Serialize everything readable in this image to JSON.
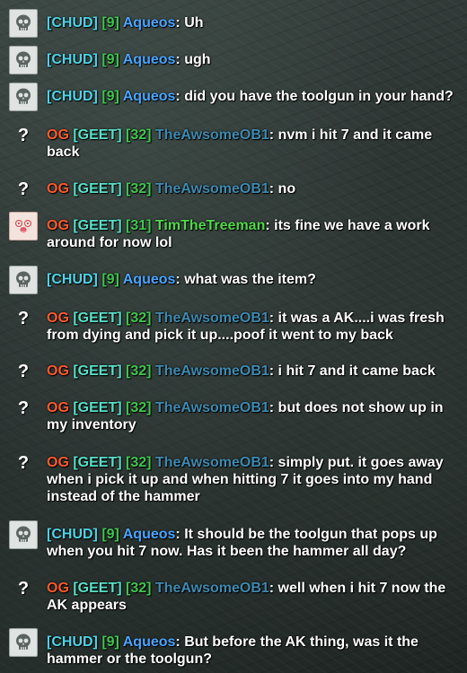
{
  "colors": {
    "og": "#ff5a2c",
    "tag_chud": "#4fd3e6",
    "tag_geet": "#57e0c8",
    "level": "#3fc64f",
    "aqueos": "#4aa5ff",
    "theawsomeob1": "#3f8ab0",
    "timthetreeman": "#52d84a",
    "message_text": "#ffffff"
  },
  "messages": [
    {
      "avatar": "skull-avatar",
      "prefix": "",
      "tag": "[CHUD]",
      "level": "[9]",
      "name": "Aqueos",
      "text": ": Uh"
    },
    {
      "avatar": "skull-avatar",
      "prefix": "",
      "tag": "[CHUD]",
      "level": "[9]",
      "name": "Aqueos",
      "text": ": ugh"
    },
    {
      "avatar": "skull-avatar",
      "prefix": "",
      "tag": "[CHUD]",
      "level": "[9]",
      "name": "Aqueos",
      "text": ": did you have the toolgun in your hand?"
    },
    {
      "avatar": "unknown-avatar",
      "avatar_glyph": "?",
      "prefix": "OG",
      "tag": "[GEET]",
      "level": "[32]",
      "name": "TheAwsomeOB1",
      "text": ": nvm i hit 7 and it came back"
    },
    {
      "avatar": "unknown-avatar",
      "avatar_glyph": "?",
      "prefix": "OG",
      "tag": "[GEET]",
      "level": "[32]",
      "name": "TheAwsomeOB1",
      "text": ": no"
    },
    {
      "avatar": "face-avatar",
      "prefix": "OG",
      "tag": "[GEET]",
      "level": "[31]",
      "name": "TimTheTreeman",
      "text": ": its fine we have a work around for now lol"
    },
    {
      "avatar": "skull-avatar",
      "prefix": "",
      "tag": "[CHUD]",
      "level": "[9]",
      "name": "Aqueos",
      "text": ": what was the item?"
    },
    {
      "avatar": "unknown-avatar",
      "avatar_glyph": "?",
      "prefix": "OG",
      "tag": "[GEET]",
      "level": "[32]",
      "name": "TheAwsomeOB1",
      "text": ": it was a AK....i was fresh from dying and pick it up....poof it went to my back"
    },
    {
      "avatar": "unknown-avatar",
      "avatar_glyph": "?",
      "prefix": "OG",
      "tag": "[GEET]",
      "level": "[32]",
      "name": "TheAwsomeOB1",
      "text": ": i hit 7 and it came back"
    },
    {
      "avatar": "unknown-avatar",
      "avatar_glyph": "?",
      "prefix": "OG",
      "tag": "[GEET]",
      "level": "[32]",
      "name": "TheAwsomeOB1",
      "text": ": but does not show up in my inventory"
    },
    {
      "avatar": "unknown-avatar",
      "avatar_glyph": "?",
      "prefix": "OG",
      "tag": "[GEET]",
      "level": "[32]",
      "name": "TheAwsomeOB1",
      "text": ": simply put. it goes away when i pick it up and when hitting 7 it goes into my hand instead of the hammer"
    },
    {
      "avatar": "skull-avatar",
      "prefix": "",
      "tag": "[CHUD]",
      "level": "[9]",
      "name": "Aqueos",
      "text": ": It should be the toolgun that pops up when you hit 7 now. Has it been the hammer all day?"
    },
    {
      "avatar": "unknown-avatar",
      "avatar_glyph": "?",
      "prefix": "OG",
      "tag": "[GEET]",
      "level": "[32]",
      "name": "TheAwsomeOB1",
      "text": ": well when i hit 7 now the AK appears"
    },
    {
      "avatar": "skull-avatar",
      "prefix": "",
      "tag": "[CHUD]",
      "level": "[9]",
      "name": "Aqueos",
      "text": ": But before the AK thing, was it the hammer or the toolgun?"
    }
  ]
}
